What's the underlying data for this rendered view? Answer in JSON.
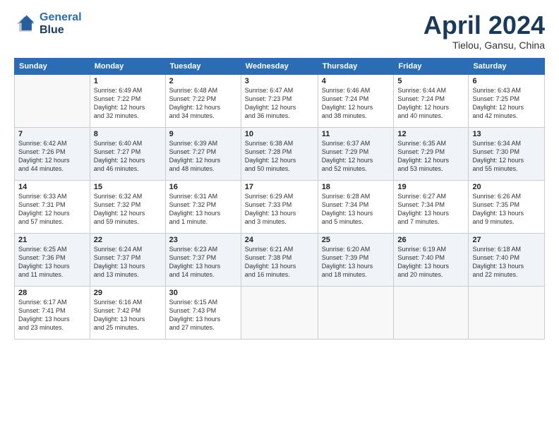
{
  "header": {
    "logo_line1": "General",
    "logo_line2": "Blue",
    "month": "April 2024",
    "location": "Tielou, Gansu, China"
  },
  "days_of_week": [
    "Sunday",
    "Monday",
    "Tuesday",
    "Wednesday",
    "Thursday",
    "Friday",
    "Saturday"
  ],
  "weeks": [
    [
      {
        "day": "",
        "info": ""
      },
      {
        "day": "1",
        "info": "Sunrise: 6:49 AM\nSunset: 7:22 PM\nDaylight: 12 hours\nand 32 minutes."
      },
      {
        "day": "2",
        "info": "Sunrise: 6:48 AM\nSunset: 7:22 PM\nDaylight: 12 hours\nand 34 minutes."
      },
      {
        "day": "3",
        "info": "Sunrise: 6:47 AM\nSunset: 7:23 PM\nDaylight: 12 hours\nand 36 minutes."
      },
      {
        "day": "4",
        "info": "Sunrise: 6:46 AM\nSunset: 7:24 PM\nDaylight: 12 hours\nand 38 minutes."
      },
      {
        "day": "5",
        "info": "Sunrise: 6:44 AM\nSunset: 7:24 PM\nDaylight: 12 hours\nand 40 minutes."
      },
      {
        "day": "6",
        "info": "Sunrise: 6:43 AM\nSunset: 7:25 PM\nDaylight: 12 hours\nand 42 minutes."
      }
    ],
    [
      {
        "day": "7",
        "info": "Sunrise: 6:42 AM\nSunset: 7:26 PM\nDaylight: 12 hours\nand 44 minutes."
      },
      {
        "day": "8",
        "info": "Sunrise: 6:40 AM\nSunset: 7:27 PM\nDaylight: 12 hours\nand 46 minutes."
      },
      {
        "day": "9",
        "info": "Sunrise: 6:39 AM\nSunset: 7:27 PM\nDaylight: 12 hours\nand 48 minutes."
      },
      {
        "day": "10",
        "info": "Sunrise: 6:38 AM\nSunset: 7:28 PM\nDaylight: 12 hours\nand 50 minutes."
      },
      {
        "day": "11",
        "info": "Sunrise: 6:37 AM\nSunset: 7:29 PM\nDaylight: 12 hours\nand 52 minutes."
      },
      {
        "day": "12",
        "info": "Sunrise: 6:35 AM\nSunset: 7:29 PM\nDaylight: 12 hours\nand 53 minutes."
      },
      {
        "day": "13",
        "info": "Sunrise: 6:34 AM\nSunset: 7:30 PM\nDaylight: 12 hours\nand 55 minutes."
      }
    ],
    [
      {
        "day": "14",
        "info": "Sunrise: 6:33 AM\nSunset: 7:31 PM\nDaylight: 12 hours\nand 57 minutes."
      },
      {
        "day": "15",
        "info": "Sunrise: 6:32 AM\nSunset: 7:32 PM\nDaylight: 12 hours\nand 59 minutes."
      },
      {
        "day": "16",
        "info": "Sunrise: 6:31 AM\nSunset: 7:32 PM\nDaylight: 13 hours\nand 1 minute."
      },
      {
        "day": "17",
        "info": "Sunrise: 6:29 AM\nSunset: 7:33 PM\nDaylight: 13 hours\nand 3 minutes."
      },
      {
        "day": "18",
        "info": "Sunrise: 6:28 AM\nSunset: 7:34 PM\nDaylight: 13 hours\nand 5 minutes."
      },
      {
        "day": "19",
        "info": "Sunrise: 6:27 AM\nSunset: 7:34 PM\nDaylight: 13 hours\nand 7 minutes."
      },
      {
        "day": "20",
        "info": "Sunrise: 6:26 AM\nSunset: 7:35 PM\nDaylight: 13 hours\nand 9 minutes."
      }
    ],
    [
      {
        "day": "21",
        "info": "Sunrise: 6:25 AM\nSunset: 7:36 PM\nDaylight: 13 hours\nand 11 minutes."
      },
      {
        "day": "22",
        "info": "Sunrise: 6:24 AM\nSunset: 7:37 PM\nDaylight: 13 hours\nand 13 minutes."
      },
      {
        "day": "23",
        "info": "Sunrise: 6:23 AM\nSunset: 7:37 PM\nDaylight: 13 hours\nand 14 minutes."
      },
      {
        "day": "24",
        "info": "Sunrise: 6:21 AM\nSunset: 7:38 PM\nDaylight: 13 hours\nand 16 minutes."
      },
      {
        "day": "25",
        "info": "Sunrise: 6:20 AM\nSunset: 7:39 PM\nDaylight: 13 hours\nand 18 minutes."
      },
      {
        "day": "26",
        "info": "Sunrise: 6:19 AM\nSunset: 7:40 PM\nDaylight: 13 hours\nand 20 minutes."
      },
      {
        "day": "27",
        "info": "Sunrise: 6:18 AM\nSunset: 7:40 PM\nDaylight: 13 hours\nand 22 minutes."
      }
    ],
    [
      {
        "day": "28",
        "info": "Sunrise: 6:17 AM\nSunset: 7:41 PM\nDaylight: 13 hours\nand 23 minutes."
      },
      {
        "day": "29",
        "info": "Sunrise: 6:16 AM\nSunset: 7:42 PM\nDaylight: 13 hours\nand 25 minutes."
      },
      {
        "day": "30",
        "info": "Sunrise: 6:15 AM\nSunset: 7:43 PM\nDaylight: 13 hours\nand 27 minutes."
      },
      {
        "day": "",
        "info": ""
      },
      {
        "day": "",
        "info": ""
      },
      {
        "day": "",
        "info": ""
      },
      {
        "day": "",
        "info": ""
      }
    ]
  ]
}
